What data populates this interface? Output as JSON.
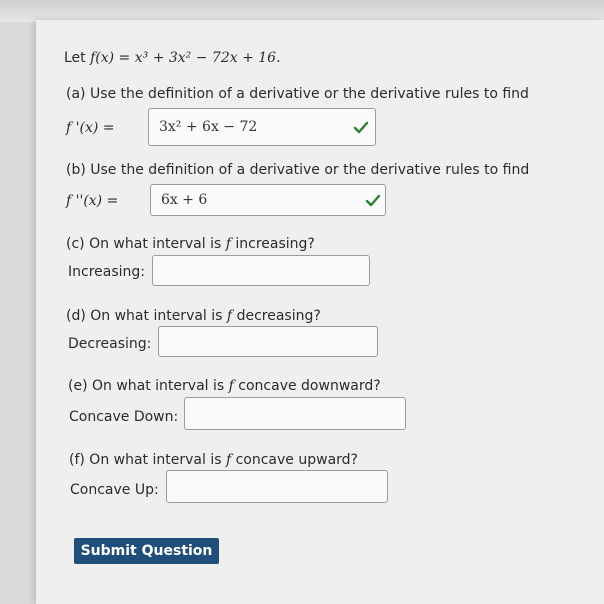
{
  "problem": {
    "prefix": "Let",
    "function_text": "f(x) = x³ + 3x² − 72x + 16."
  },
  "parts": [
    {
      "prompt": "(a) Use the definition of a derivative or the derivative rules to find",
      "label": "f '(x) =",
      "answer": "3x² + 6x − 72",
      "status": "correct"
    },
    {
      "prompt": "(b) Use the definition of a derivative or the derivative rules to find",
      "label": "f ''(x) =",
      "answer": "6x + 6",
      "status": "correct"
    },
    {
      "prompt_pre": "(c) On what interval is",
      "prompt_fn": "f",
      "prompt_post": "increasing?",
      "label": "Increasing:",
      "answer": ""
    },
    {
      "prompt_pre": "(d) On what interval is",
      "prompt_fn": "f",
      "prompt_post": "decreasing?",
      "label": "Decreasing:",
      "answer": ""
    },
    {
      "prompt_pre": "(e) On what interval is",
      "prompt_fn": "f",
      "prompt_post": "concave downward?",
      "label": "Concave Down:",
      "answer": ""
    },
    {
      "prompt_pre": "(f) On what interval is",
      "prompt_fn": "f",
      "prompt_post": "concave upward?",
      "label": "Concave Up:",
      "answer": ""
    }
  ],
  "submit_label": "Submit Question",
  "colors": {
    "check": "#2e7d32",
    "submit_bg": "#1f4e7a",
    "page_bg": "#efefef"
  },
  "icons": {
    "correct": "checkmark-icon"
  }
}
